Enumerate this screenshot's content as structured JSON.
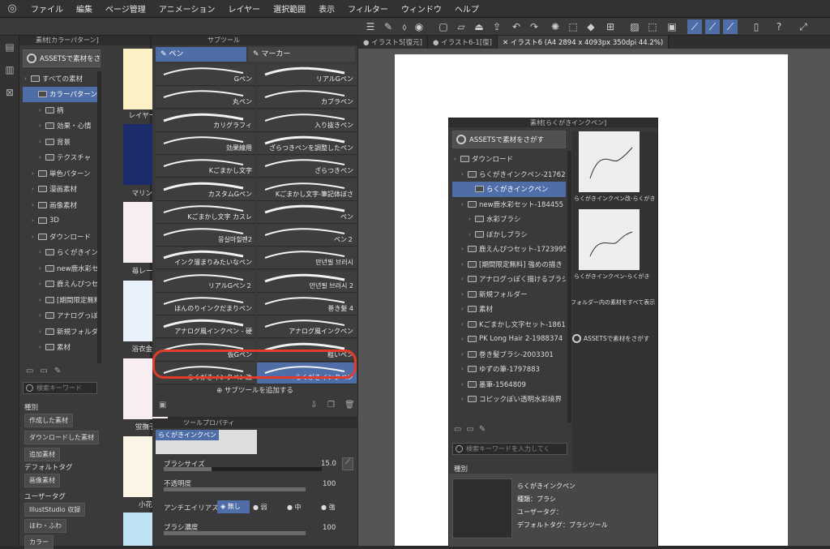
{
  "menu": [
    "ファイル",
    "編集",
    "ページ管理",
    "アニメーション",
    "レイヤー",
    "選択範囲",
    "表示",
    "フィルター",
    "ウィンドウ",
    "ヘルプ"
  ],
  "tabs": [
    "イラスト5[復元]",
    "イラスト6-1[復]",
    "イラスト6 (A4 2894 x 4093px 350dpi 44.2%)"
  ],
  "material_panel": {
    "title": "素材[カラーパターン]",
    "assets_button": "ASSETSで素材をさがす",
    "tree": [
      {
        "label": "すべての素材",
        "indent": 0,
        "selected": false
      },
      {
        "label": "カラーパターン",
        "indent": 1,
        "selected": true
      },
      {
        "label": "柄",
        "indent": 2,
        "selected": false
      },
      {
        "label": "効果・心情",
        "indent": 2,
        "selected": false
      },
      {
        "label": "背景",
        "indent": 2,
        "selected": false
      },
      {
        "label": "テクスチャ",
        "indent": 2,
        "selected": false
      },
      {
        "label": "単色パターン",
        "indent": 1,
        "selected": false
      },
      {
        "label": "漫画素材",
        "indent": 1,
        "selected": false
      },
      {
        "label": "画像素材",
        "indent": 1,
        "selected": false
      },
      {
        "label": "3D",
        "indent": 1,
        "selected": false
      },
      {
        "label": "ダウンロード",
        "indent": 1,
        "selected": false
      },
      {
        "label": "らくがきインク",
        "indent": 2,
        "selected": false
      },
      {
        "label": "new鹿水彩セ",
        "indent": 2,
        "selected": false
      },
      {
        "label": "鹿えんぴつセ",
        "indent": 2,
        "selected": false
      },
      {
        "label": "[期間限定無料",
        "indent": 2,
        "selected": false
      },
      {
        "label": "アナログっぽ",
        "indent": 2,
        "selected": false
      },
      {
        "label": "新規フォルダー",
        "indent": 2,
        "selected": false
      },
      {
        "label": "素材",
        "indent": 2,
        "selected": false
      }
    ],
    "search_placeholder": "検索キーワード",
    "kind_label": "種別",
    "kind_buttons": [
      "作成した素材",
      "ダウンロードした素材",
      "追加素材"
    ],
    "default_tag_label": "デフォルトタグ",
    "default_tag_buttons": [
      "画像素材"
    ],
    "user_tag_label": "ユーザータグ",
    "user_tag_buttons": [
      "IllustStudio 収録",
      "ほわ・ふわ",
      "カラー"
    ],
    "thumbs": [
      "レイヤー 2",
      "マリン柄",
      "苺レース",
      "浴衣金魚",
      "蛍撫子",
      "小花"
    ],
    "thumb_colors": [
      "#fbf1c4",
      "#1c2b6b",
      "#f6eef0",
      "#e9f2fb",
      "#f8eef2",
      "#fbf5e6",
      "#bfe3f5"
    ]
  },
  "sub_tool": {
    "title": "サブツール",
    "tabs": [
      "ペン",
      "マーカー"
    ],
    "brushes": [
      "Gペン",
      "リアルGペン",
      "丸ペン",
      "カブラペン",
      "カリグラフィ",
      "入り抜きペン",
      "効果線用",
      "ざらつきペンを調整したペン",
      "Kごまかし文字",
      "ざらつきペン",
      "カスタムGペン",
      "Kごまかし文字-筆記体ぼさ",
      "Kごまかし文字 カスレ",
      "ペン",
      "몽실마힐펜2",
      "ペン２",
      "インク溜まりみたいなペン",
      "만년필 브러시",
      "リアルGペン２",
      "만년필 브러시 2",
      "ほんのりインクだまりペン",
      "巻き髪 4",
      "アナログ風インクペン - 硬",
      "アナログ風インクペン",
      "仮Gペン",
      "粗いペン",
      "らくがきインクペン改",
      "らくがきインクペン"
    ],
    "selected_index": 27,
    "add_label": "サブツールを追加する"
  },
  "tool_property": {
    "title": "ツールプロパティ",
    "brush_name": "らくがきインクペン",
    "brush_size_label": "ブラシサイズ",
    "brush_size_value": "15.0",
    "brush_size_fraction": 0.3,
    "opacity_label": "不透明度",
    "opacity_value": "100",
    "antialias_label": "アンチエイリアス",
    "antialias_options": [
      "無し",
      "弱",
      "中",
      "強"
    ],
    "density_label": "ブラシ濃度",
    "density_value": "100"
  },
  "float_window": {
    "title": "素材[らくがきインクペン]",
    "assets_button": "ASSETSで素材をさがす",
    "tree": [
      {
        "label": "ダウンロード",
        "indent": 0,
        "selected": false
      },
      {
        "label": "らくがきインクペン-21762",
        "indent": 1,
        "selected": false
      },
      {
        "label": "らくがきインクペン",
        "indent": 2,
        "selected": true
      },
      {
        "label": "new鹿水彩セット-184455",
        "indent": 1,
        "selected": false
      },
      {
        "label": "水彩ブラシ",
        "indent": 2,
        "selected": false
      },
      {
        "label": "ぼかしブラシ",
        "indent": 2,
        "selected": false
      },
      {
        "label": "鹿えんぴつセット-1723995",
        "indent": 1,
        "selected": false
      },
      {
        "label": "[期間限定無料] 強めの描き",
        "indent": 1,
        "selected": false
      },
      {
        "label": "アナログっぽく描けるブラシ",
        "indent": 1,
        "selected": false
      },
      {
        "label": "新規フォルダー",
        "indent": 1,
        "selected": false
      },
      {
        "label": "素材",
        "indent": 1,
        "selected": false
      },
      {
        "label": "Kごまかし文字セット-1861",
        "indent": 1,
        "selected": false
      },
      {
        "label": "PK Long Hair 2-1988374",
        "indent": 1,
        "selected": false
      },
      {
        "label": "巻き髪ブラシ-2003301",
        "indent": 1,
        "selected": false
      },
      {
        "label": "ゆずの筆-1797883",
        "indent": 1,
        "selected": false
      },
      {
        "label": "墨筆-1564809",
        "indent": 1,
        "selected": false
      },
      {
        "label": "コピックぽい透明水彩境界",
        "indent": 1,
        "selected": false
      }
    ],
    "previews": [
      "らくがきインクペン改-らくがき",
      "らくがきインクペン-らくがき"
    ],
    "show_all": "フォルダー内の素材をすべて表示",
    "assets_button2": "ASSETSで素材をさがす",
    "search_placeholder": "検索キーワードを入力してく",
    "kind_label": "種別",
    "info_name": "らくがきインクペン",
    "info_kind": "種類：ブラシ",
    "info_user_tag": "ユーザータグ：",
    "info_default_tag": "デフォルトタグ：ブラシツール"
  },
  "colors": {
    "accent": "#4f6ea8",
    "highlight": "#e23b2a"
  }
}
